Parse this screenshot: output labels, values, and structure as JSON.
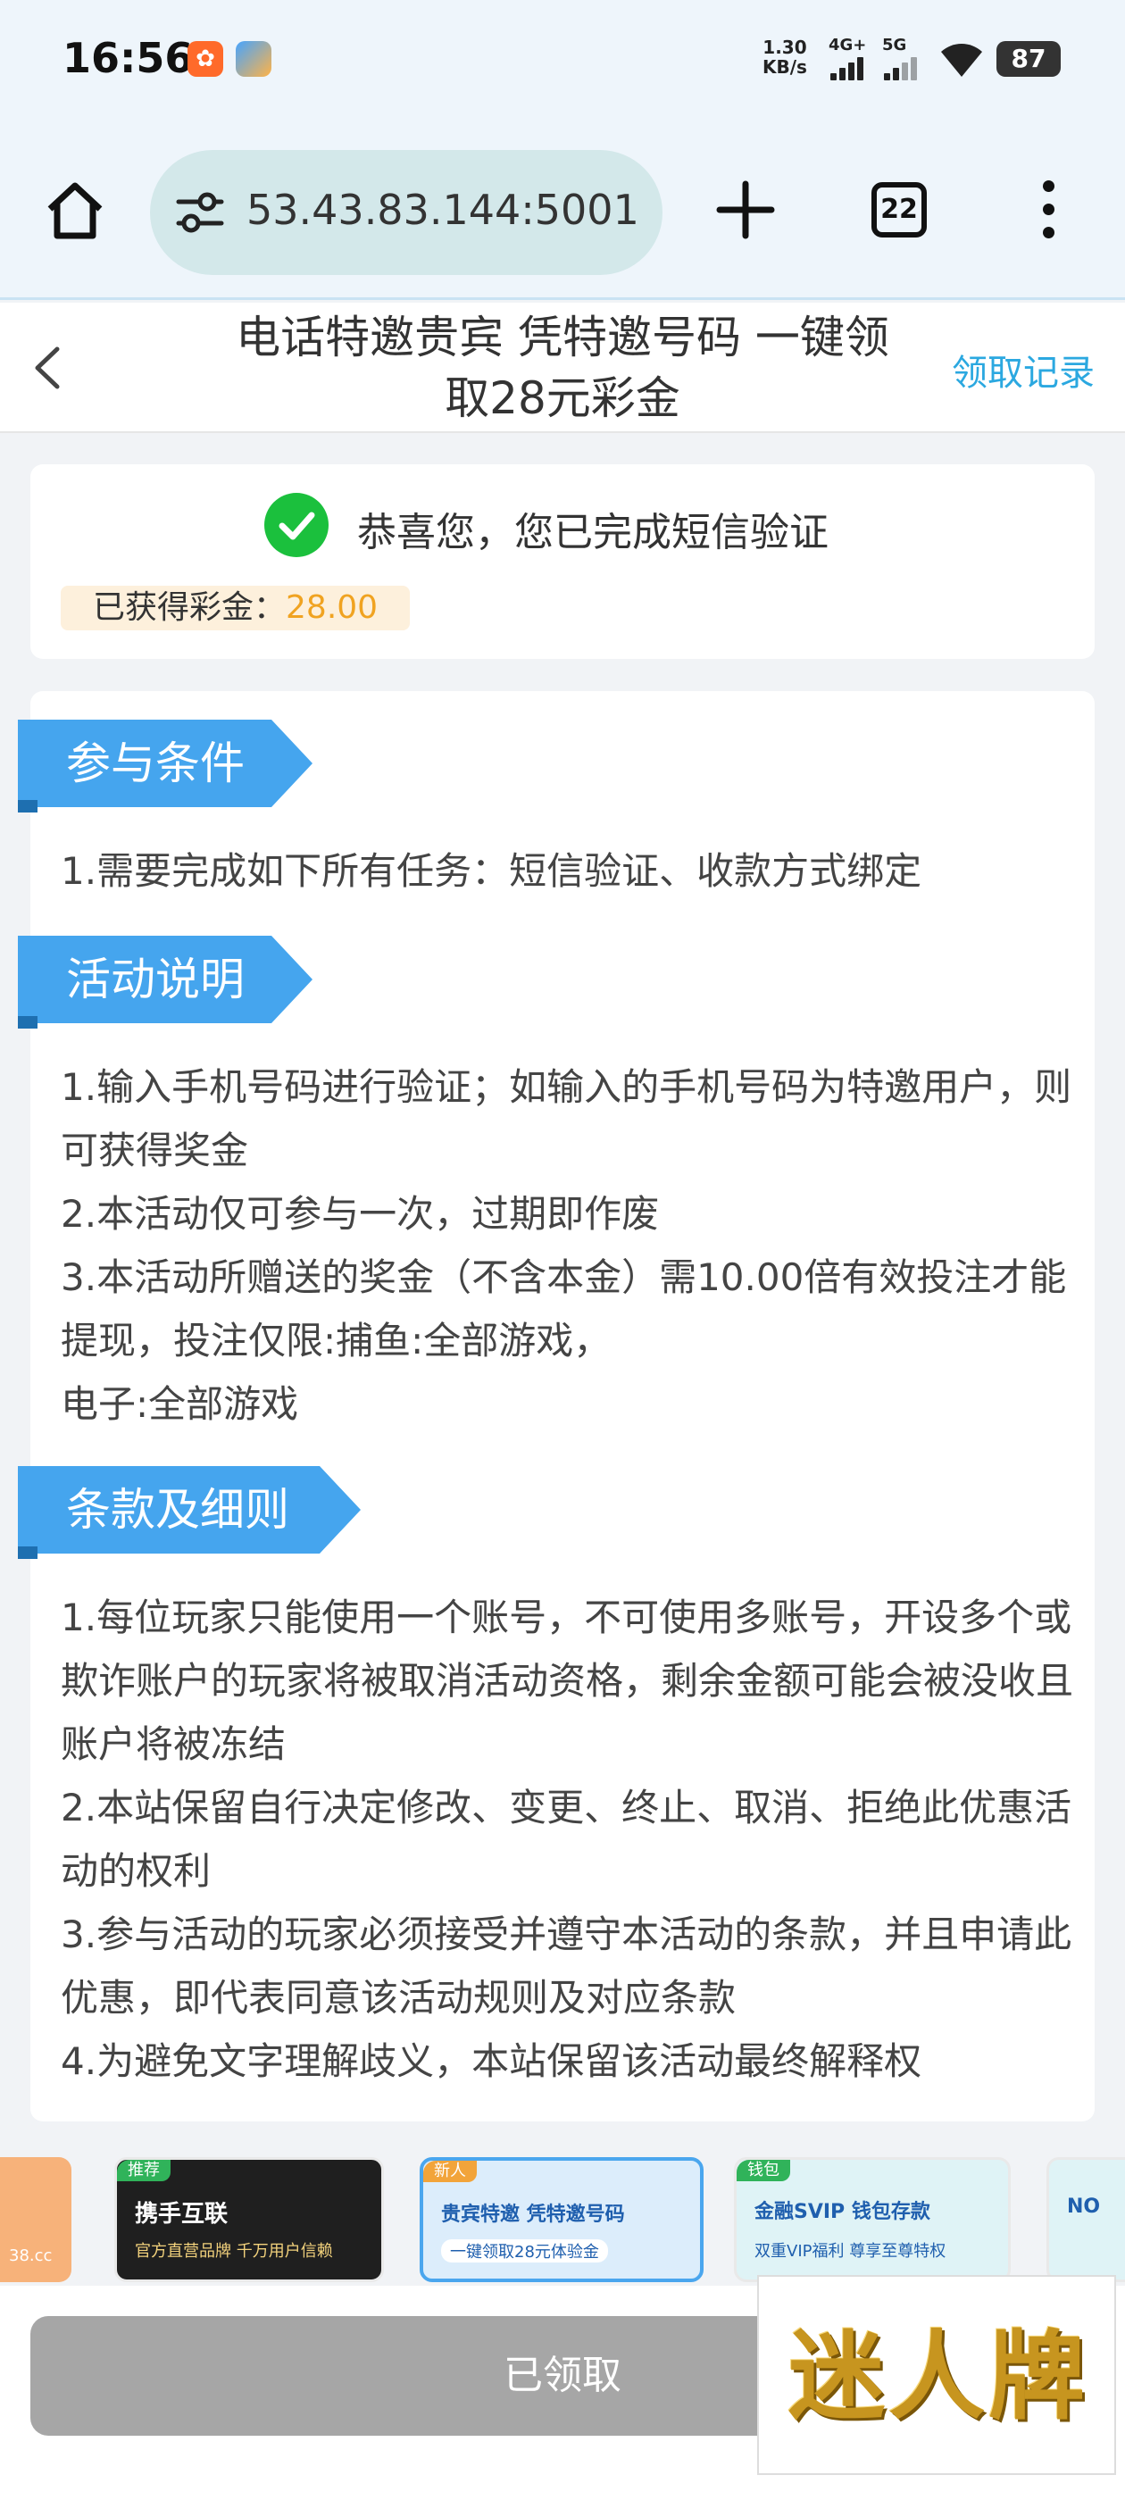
{
  "status_bar": {
    "time": "16:56",
    "speed_value": "1.30",
    "speed_unit": "KB/s",
    "net1": "4G+",
    "net2": "5G",
    "battery": "87"
  },
  "browser": {
    "url": "53.43.83.144:5001",
    "tab_count": "22"
  },
  "header": {
    "title": "电话特邀贵宾 凭特邀号码 一键领取28元彩金",
    "records_link": "领取记录"
  },
  "success": {
    "message": "恭喜您，您已完成短信验证",
    "bonus_label": "已获得彩金：",
    "bonus_amount": "28.00"
  },
  "sections": [
    {
      "title": "参与条件",
      "lines": [
        "1.需要完成如下所有任务：短信验证、收款方式绑定"
      ]
    },
    {
      "title": "活动说明",
      "lines": [
        "1.输入手机号码进行验证；如输入的手机号码为特邀用户，则可获得奖金",
        "2.本活动仅可参与一次，过期即作废",
        "3.本活动所赠送的奖金（不含本金）需10.00倍有效投注才能提现，投注仅限:捕鱼:全部游戏，",
        "电子:全部游戏"
      ]
    },
    {
      "title": "条款及细则",
      "lines": [
        "1.每位玩家只能使用一个账号，不可使用多账号，开设多个或欺诈账户的玩家将被取消活动资格，剩余金额可能会被没收且账户将被冻结",
        "2.本站保留自行决定修改、变更、终止、取消、拒绝此优惠活动的权利",
        "3.参与活动的玩家必须接受并遵守本活动的条款，并且申请此优惠，即代表同意该活动规则及对应条款",
        "4.为避免文字理解歧义，本站保留该活动最终解释权"
      ]
    }
  ],
  "banners": [
    {
      "tag": "",
      "title": "",
      "subtitle": "38.cc",
      "color": "#e86a2a"
    },
    {
      "tag": "推荐",
      "title": "携手互联",
      "subtitle": "官方直营品牌 千万用户信赖",
      "color": "#1f1f1f"
    },
    {
      "tag": "新人",
      "title": "贵宾特邀 凭特邀号码",
      "subtitle": "一键领取28元体验金",
      "color": "#cfe6fb"
    },
    {
      "tag": "钱包",
      "title": "金融SVIP 钱包存款",
      "subtitle": "双重VIP福利 尊享至尊特权",
      "color": "#dff3f6"
    },
    {
      "tag": "",
      "title": "NO",
      "subtitle": "",
      "color": "#dff3f6"
    }
  ],
  "bottom": {
    "claim_button": "已领取",
    "logo_text": "迷人牌"
  }
}
